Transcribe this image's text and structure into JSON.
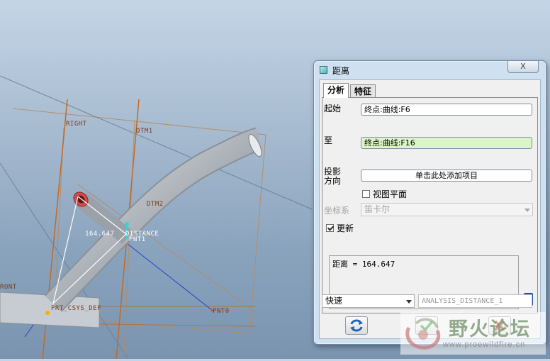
{
  "viewport": {
    "labels": {
      "right": "RIGHT",
      "dtm1": "DTM1",
      "dtm2": "DTM2",
      "front": "RONT",
      "csys": "PRT_CSYS_DEF",
      "pnt0": "PNT0",
      "pnt1": "PNT1",
      "distance_value": "164.647",
      "distance_name": "DISTANCE"
    }
  },
  "dialog": {
    "title": "距离",
    "close_glyph": "X",
    "tabs": [
      {
        "label": "分析",
        "active": true
      },
      {
        "label": "特征",
        "active": false
      }
    ],
    "from": {
      "label": "起始",
      "value": "终点:曲线:F6"
    },
    "to": {
      "label": "至",
      "value": "终点:曲线:F16"
    },
    "projection": {
      "label_line1": "投影",
      "label_line2": "方向",
      "button": "单击此处添加项目"
    },
    "view_plane": {
      "label": "视图平面",
      "checked": false
    },
    "coord_system": {
      "label": "坐标系",
      "value": "笛卡尔",
      "enabled": false
    },
    "update": {
      "label": "更新",
      "checked": true
    },
    "result": "距离  = 164.647",
    "mode": {
      "value": "快速"
    },
    "analysis_name": {
      "value": "ANALYSIS_DISTANCE_1"
    }
  },
  "watermark": {
    "title": "野火论坛",
    "url": "www.proewildfire.cn"
  },
  "colors": {
    "accent": "#2d7fd0",
    "ok": "#2e9a2e",
    "cancel": "#c0392b",
    "datum": "#c07030",
    "highlight": "#dcf5c8"
  }
}
